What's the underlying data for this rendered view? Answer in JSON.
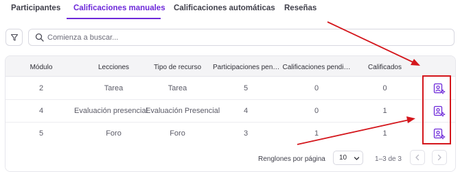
{
  "tabs": [
    {
      "label": "Participantes",
      "active": false
    },
    {
      "label": "Calificaciones manuales",
      "active": true
    },
    {
      "label": "Calificaciones automáticas",
      "active": false
    },
    {
      "label": "Reseñas",
      "active": false
    }
  ],
  "search": {
    "placeholder": "Comienza a buscar..."
  },
  "table": {
    "columns": [
      "Módulo",
      "Lecciones",
      "Tipo de recurso",
      "Participaciones pen…",
      "Calificaciones pendi…",
      "Calificados"
    ],
    "rows": [
      {
        "modulo": "2",
        "lecciones": "Tarea",
        "tipo": "Tarea",
        "participaciones": "5",
        "pendientes": "0",
        "calificados": "0"
      },
      {
        "modulo": "4",
        "lecciones": "Evaluación presencial",
        "tipo": "Evaluación Presencial",
        "participaciones": "4",
        "pendientes": "0",
        "calificados": "1"
      },
      {
        "modulo": "5",
        "lecciones": "Foro",
        "tipo": "Foro",
        "participaciones": "3",
        "pendientes": "1",
        "calificados": "1"
      }
    ]
  },
  "pagination": {
    "rows_per_page_label": "Renglones por página",
    "rows_per_page_value": "10",
    "range": "1–3 de 3"
  },
  "colors": {
    "accent": "#6d28d9",
    "annotation": "#d4161c"
  },
  "icons": [
    "filter-icon",
    "search-icon",
    "grade-user-icon",
    "chevron-down-icon",
    "chevron-left-icon",
    "chevron-right-icon"
  ]
}
